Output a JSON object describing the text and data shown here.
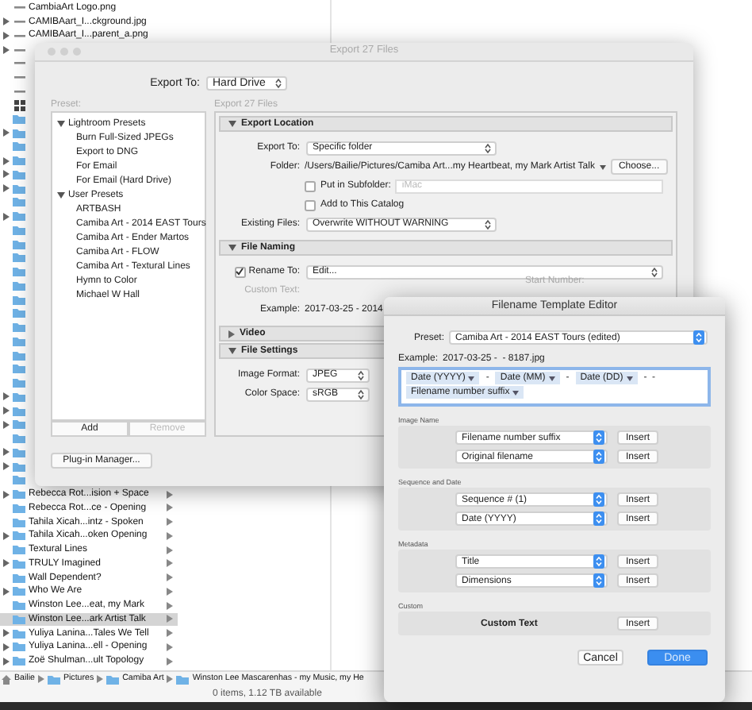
{
  "finder": {
    "rows": [
      {
        "name": "CambiaArt Logo.png",
        "kind": "file",
        "expandable": false,
        "selected": false
      },
      {
        "name": "CAMIBAart_I...ckground.jpg",
        "kind": "file",
        "expandable": true,
        "selected": false
      },
      {
        "name": "CAMIBAart_I...parent_a.png",
        "kind": "file",
        "expandable": true,
        "selected": false
      },
      {
        "kind": "file",
        "expandable": true,
        "selected": false
      },
      {
        "kind": "file",
        "expandable": false,
        "selected": false
      },
      {
        "kind": "file",
        "expandable": false,
        "selected": false
      },
      {
        "kind": "file",
        "expandable": false,
        "selected": false
      },
      {
        "kind": "grid",
        "expandable": false,
        "selected": false
      },
      {
        "kind": "folder",
        "expandable": false,
        "selected": false
      },
      {
        "kind": "folder",
        "expandable": true,
        "selected": false
      },
      {
        "kind": "folder",
        "expandable": false,
        "selected": false
      },
      {
        "kind": "folder",
        "expandable": true,
        "selected": false
      },
      {
        "kind": "folder",
        "expandable": true,
        "selected": false
      },
      {
        "kind": "folder",
        "expandable": true,
        "selected": false
      },
      {
        "kind": "folder",
        "expandable": false,
        "selected": false
      },
      {
        "kind": "folder",
        "expandable": true,
        "selected": false
      },
      {
        "kind": "folder",
        "expandable": false,
        "selected": false
      },
      {
        "kind": "folder",
        "expandable": false,
        "selected": false
      },
      {
        "kind": "folder",
        "expandable": false,
        "selected": false
      },
      {
        "kind": "folder",
        "expandable": false,
        "selected": false
      },
      {
        "kind": "folder",
        "expandable": false,
        "selected": false
      },
      {
        "kind": "folder",
        "expandable": false,
        "selected": false
      },
      {
        "kind": "folder",
        "expandable": false,
        "selected": false
      },
      {
        "kind": "folder",
        "expandable": false,
        "selected": false
      },
      {
        "kind": "folder",
        "expandable": false,
        "selected": false
      },
      {
        "kind": "folder",
        "expandable": false,
        "selected": false
      },
      {
        "kind": "folder",
        "expandable": false,
        "selected": false
      },
      {
        "kind": "folder",
        "expandable": false,
        "selected": false
      },
      {
        "kind": "folder",
        "expandable": true,
        "selected": false
      },
      {
        "kind": "folder",
        "expandable": true,
        "selected": false
      },
      {
        "kind": "folder",
        "expandable": true,
        "selected": false
      },
      {
        "kind": "folder",
        "expandable": false,
        "selected": false
      },
      {
        "kind": "folder",
        "expandable": true,
        "selected": false
      },
      {
        "kind": "folder",
        "expandable": true,
        "selected": false
      },
      {
        "kind": "folder",
        "expandable": false,
        "selected": false
      },
      {
        "name": "Rebecca Rot...ision + Space",
        "kind": "folder",
        "expandable": true,
        "selected": false
      },
      {
        "name": "Rebecca Rot...ce - Opening",
        "kind": "folder",
        "expandable": false,
        "selected": false
      },
      {
        "name": "Tahila Xicah...intz - Spoken",
        "kind": "folder",
        "expandable": false,
        "selected": false
      },
      {
        "name": "Tahila Xicah...oken Opening",
        "kind": "folder",
        "expandable": true,
        "selected": false
      },
      {
        "name": "Textural Lines",
        "kind": "folder",
        "expandable": false,
        "selected": false
      },
      {
        "name": "TRULY Imagined",
        "kind": "folder",
        "expandable": true,
        "selected": false
      },
      {
        "name": "Wall Dependent?",
        "kind": "folder",
        "expandable": false,
        "selected": false
      },
      {
        "name": "Who We Are",
        "kind": "folder",
        "expandable": true,
        "selected": false
      },
      {
        "name": "Winston Lee...eat, my Mark",
        "kind": "folder",
        "expandable": false,
        "selected": false
      },
      {
        "name": "Winston Lee...ark Artist Talk",
        "kind": "folder",
        "expandable": false,
        "selected": true
      },
      {
        "name": "Yuliya Lanina...Tales We Tell",
        "kind": "folder",
        "expandable": true,
        "selected": false
      },
      {
        "name": "Yuliya Lanina...ell - Opening",
        "kind": "folder",
        "expandable": true,
        "selected": false
      },
      {
        "name": "Zoë Shulman...ult Topology",
        "kind": "folder",
        "expandable": true,
        "selected": false
      }
    ],
    "path": [
      {
        "name": "Bailie",
        "kind": "home"
      },
      {
        "name": "Pictures",
        "kind": "folder"
      },
      {
        "name": "Camiba Art",
        "kind": "folder"
      },
      {
        "name": "Winston Lee Mascarenhas - my Music, my He",
        "kind": "folder"
      }
    ],
    "status": "0 items, 1.12 TB available"
  },
  "export_dialog": {
    "title": "Export 27 Files",
    "export_to_label": "Export To:",
    "export_to": "Hard Drive",
    "preset_label": "Preset:",
    "panel_title": "Export 27 Files",
    "presets": [
      {
        "name": "Lightroom Presets",
        "expanded": true,
        "children": [
          {
            "name": "Burn Full-Sized JPEGs"
          },
          {
            "name": "Export to DNG"
          },
          {
            "name": "For Email"
          },
          {
            "name": "For Email (Hard Drive)"
          }
        ]
      },
      {
        "name": "User Presets",
        "expanded": true,
        "children": [
          {
            "name": "ARTBASH"
          },
          {
            "name": "Camiba Art - 2014 EAST Tours"
          },
          {
            "name": "Camiba Art - Ender Martos"
          },
          {
            "name": "Camiba Art - FLOW"
          },
          {
            "name": "Camiba Art - Textural Lines"
          },
          {
            "name": "Hymn to Color"
          },
          {
            "name": "Michael W Hall"
          }
        ]
      }
    ],
    "add": "Add",
    "remove": {
      "label": "Remove",
      "disabled": true
    },
    "plugin_manager": "Plug-in Manager...",
    "sections": [
      {
        "title": "Export Location",
        "expanded": true,
        "rows": [
          {
            "kind": "popup",
            "label": "Export To:",
            "value": "Specific folder"
          },
          {
            "kind": "path",
            "label": "Folder:",
            "value": "/Users/Bailie/Pictures/Camiba Art...my Heartbeat, my Mark Artist Talk",
            "button": "Choose..."
          },
          {
            "kind": "check",
            "text": "Put in Subfolder:",
            "checked": false,
            "placeholder": "iMac"
          },
          {
            "kind": "check",
            "text": "Add to This Catalog",
            "checked": false
          },
          {
            "kind": "popup",
            "label": "Existing Files:",
            "value": "Overwrite WITHOUT WARNING"
          }
        ]
      },
      {
        "title": "File Naming",
        "expanded": true,
        "rows": [
          {
            "kind": "check_popup",
            "label": "Rename To:",
            "checked": true,
            "value": "Edit..."
          },
          {
            "kind": "field",
            "label": "Custom Text:",
            "disabled": true,
            "extra": "Start Number:"
          },
          {
            "kind": "example",
            "label": "Example:",
            "value": "2017-03-25 - 2014"
          }
        ]
      },
      {
        "title": "Video",
        "expanded": false
      },
      {
        "title": "File Settings",
        "expanded": true,
        "rows": [
          {
            "kind": "popup",
            "label": "Image Format:",
            "value": "JPEG"
          },
          {
            "kind": "popup",
            "label": "Color Space:",
            "value": "sRGB"
          }
        ]
      }
    ]
  },
  "template_editor": {
    "title": "Filename Template Editor",
    "preset_label": "Preset:",
    "preset": "Camiba Art - 2014 EAST Tours (edited)",
    "example_label": "Example:",
    "example": "2017-03-25 -  - 8187.jpg",
    "tokens": [
      {
        "kind": "token",
        "text": "Date (YYYY)"
      },
      {
        "kind": "literal",
        "text": "-"
      },
      {
        "kind": "token",
        "text": "Date (MM)"
      },
      {
        "kind": "literal",
        "text": "-"
      },
      {
        "kind": "token",
        "text": "Date (DD)"
      },
      {
        "kind": "literal",
        "text": "-  -"
      },
      {
        "kind": "token",
        "text": "Filename number suffix"
      }
    ],
    "groups": [
      {
        "title": "Image Name",
        "rows": [
          {
            "kind": "popup",
            "value": "Filename number suffix",
            "button": "Insert"
          },
          {
            "kind": "popup",
            "value": "Original filename",
            "button": "Insert"
          }
        ]
      },
      {
        "title": "Sequence and Date",
        "rows": [
          {
            "kind": "popup",
            "value": "Sequence # (1)",
            "button": "Insert"
          },
          {
            "kind": "popup",
            "value": "Date (YYYY)",
            "button": "Insert"
          }
        ]
      },
      {
        "title": "Metadata",
        "rows": [
          {
            "kind": "popup",
            "value": "Title",
            "button": "Insert"
          },
          {
            "kind": "popup",
            "value": "Dimensions",
            "button": "Insert"
          }
        ]
      },
      {
        "title": "Custom",
        "rows": [
          {
            "kind": "text",
            "value": "Custom Text",
            "button": "Insert"
          }
        ]
      }
    ],
    "buttons": [
      {
        "label": "Cancel",
        "default": false
      },
      {
        "label": "Done",
        "default": true
      }
    ]
  }
}
